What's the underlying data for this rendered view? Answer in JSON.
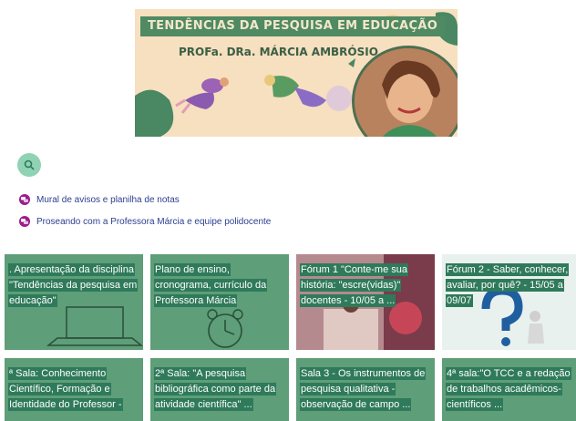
{
  "banner": {
    "title": "TENDÊNCIAS DA PESQUISA EM EDUCAÇÃO",
    "subtitle": "PROFa. DRa. MÁRCIA AMBRÓSIO"
  },
  "links": [
    {
      "label": "Mural de avisos e planilha de notas"
    },
    {
      "label": "Proseando com a Professora Márcia e equipe polidocente"
    }
  ],
  "tiles": [
    {
      "label": ". Apresentação da disciplina \"Tendências da pesquisa em educação\""
    },
    {
      "label": "Plano de ensino, cronograma, currículo da Professora Márcia"
    },
    {
      "label": "Fórum 1 \"Conte-me sua história: \"escre(vidas)\" docentes - 10/05 a ..."
    },
    {
      "label": "Fórum 2 - Saber, conhecer, avaliar, por quê? - 15/05 a 09/07"
    },
    {
      "label": "ª Sala: Conhecimento Científico, Formação e Identidade do Professor -"
    },
    {
      "label": "2ª Sala: \"A pesquisa bibliográfica como parte da atividade científica\" ..."
    },
    {
      "label": "Sala 3 - Os instrumentos de pesquisa qualitativa - observação de campo ..."
    },
    {
      "label": "4ª sala:\"O TCC e a redação de trabalhos acadêmicos-científicos ..."
    }
  ],
  "colors": {
    "tile_green": "#5e9e78",
    "label_bg": "#2f7a5a",
    "link": "#2a3f8f",
    "link_icon": "#9b1c8e",
    "search_btn": "#8fd3b4"
  }
}
